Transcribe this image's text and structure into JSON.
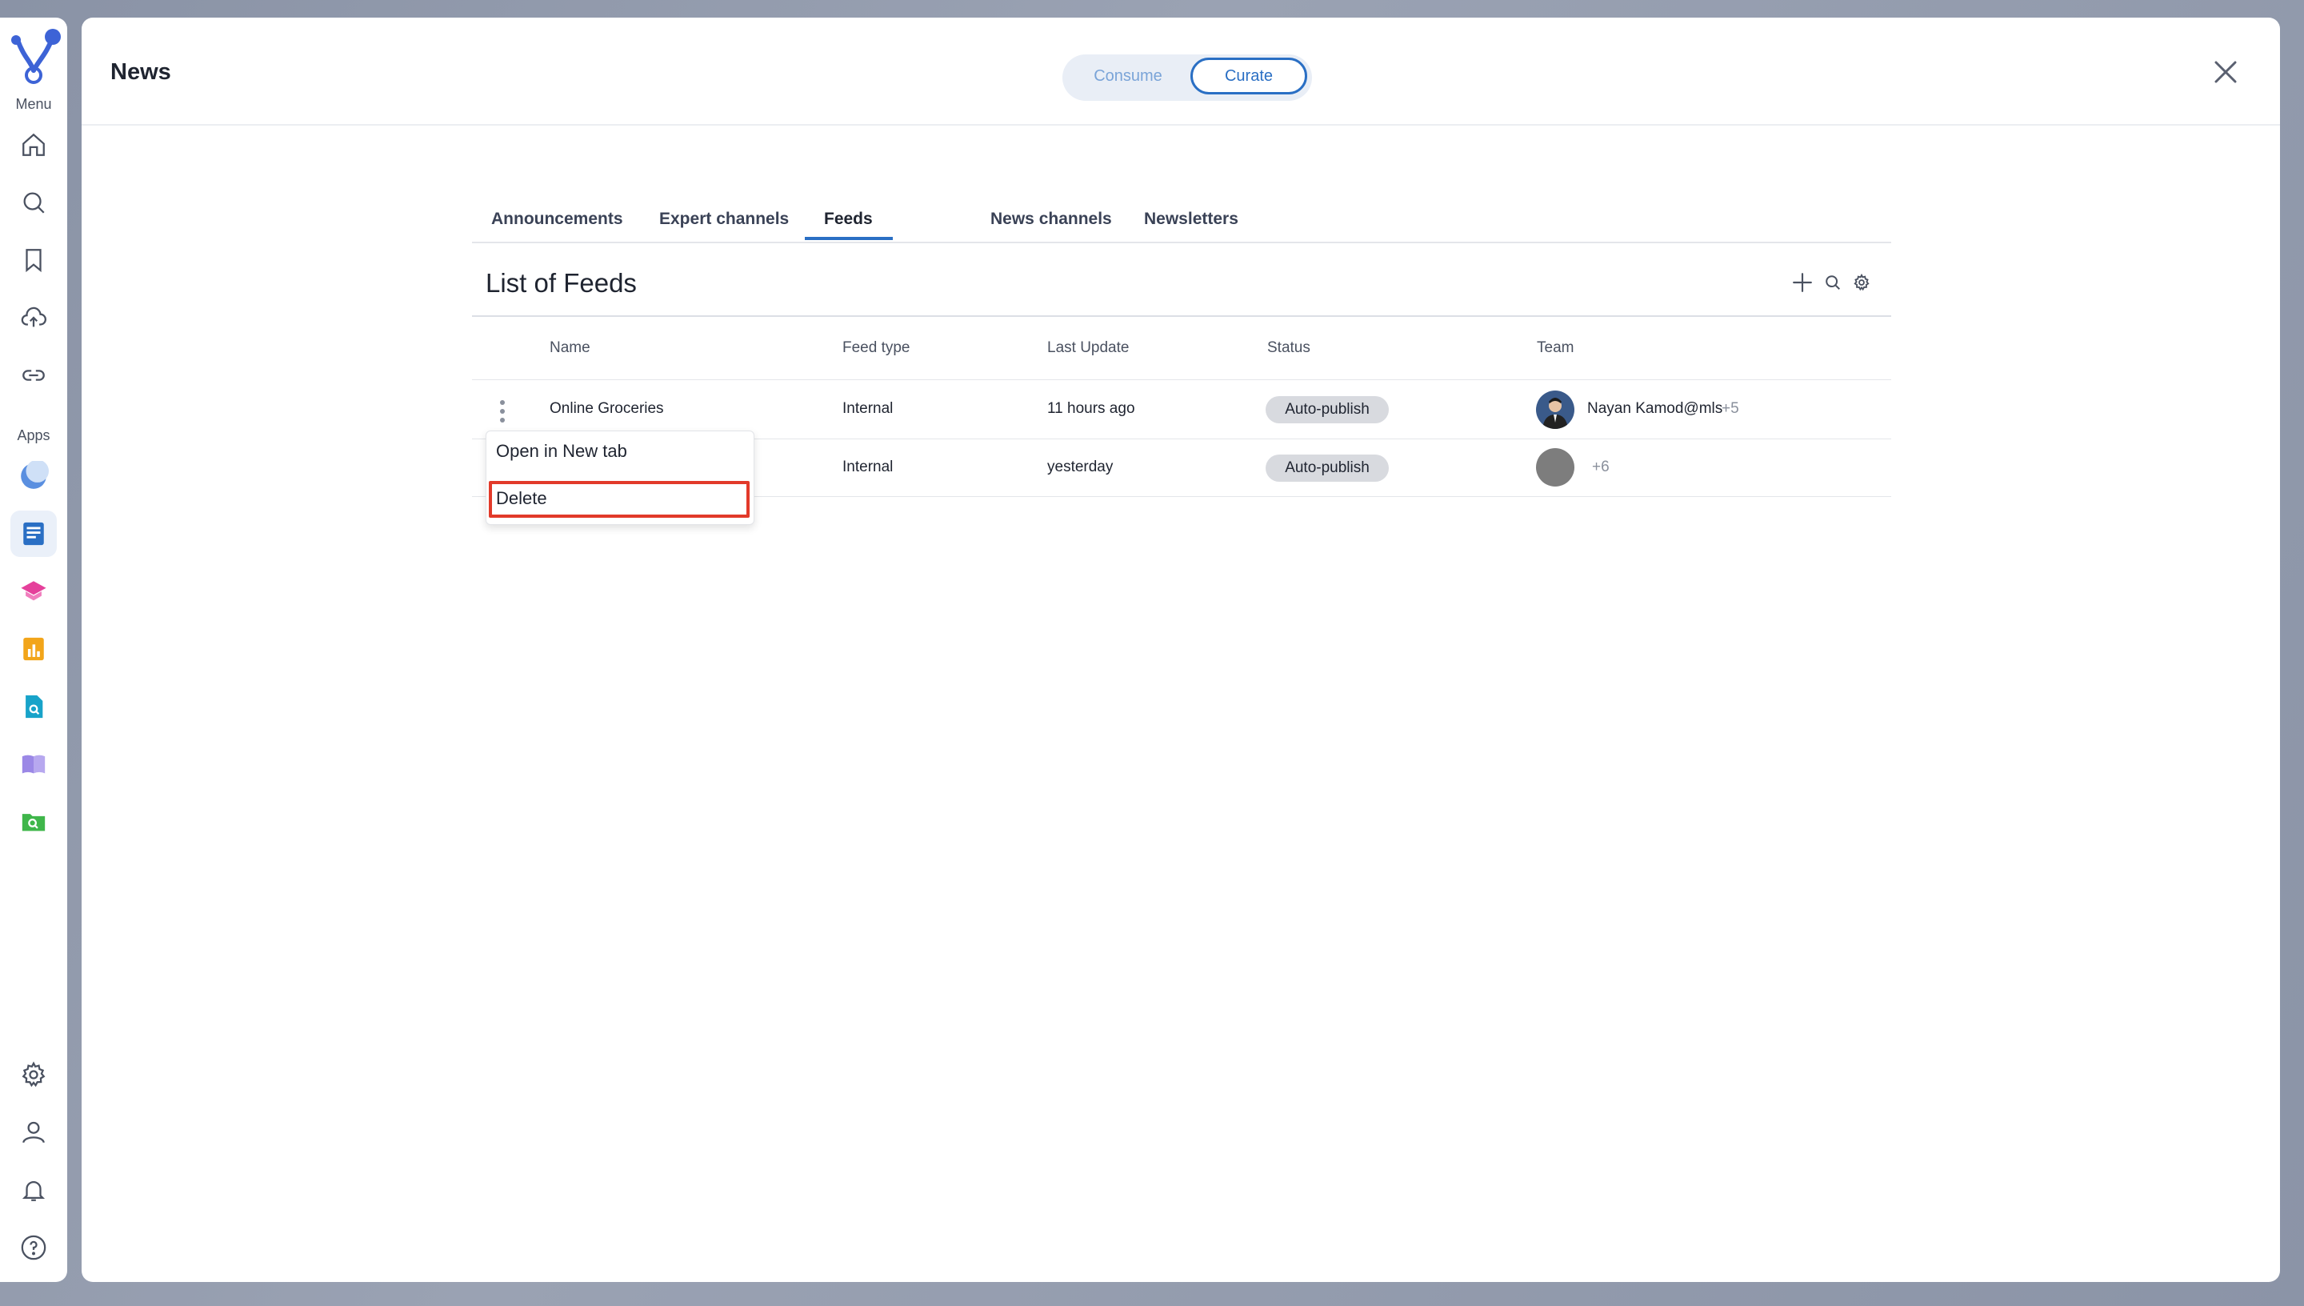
{
  "rail": {
    "menu_label": "Menu",
    "apps_label": "Apps",
    "nav_icons": [
      "home-icon",
      "search-icon",
      "bookmark-icon",
      "cloud-upload-icon",
      "link-icon"
    ],
    "app_icons": [
      "crescent-app-icon",
      "news-app-icon",
      "education-app-icon",
      "analytics-app-icon",
      "document-search-app-icon",
      "book-app-icon",
      "folder-search-app-icon"
    ],
    "bottom_icons": [
      "gear-icon",
      "user-icon",
      "bell-icon",
      "help-icon"
    ],
    "colors": {
      "brand": "#3d63d6",
      "active_bg": "#eaf0f9"
    }
  },
  "header": {
    "title": "News",
    "toggle": {
      "consume": "Consume",
      "curate": "Curate",
      "selected": "Curate"
    }
  },
  "tabs": [
    {
      "label": "Announcements"
    },
    {
      "label": "Expert channels"
    },
    {
      "label": "Feeds",
      "active": true
    },
    {
      "label": "News channels"
    },
    {
      "label": "Newsletters"
    }
  ],
  "section": {
    "title": "List of Feeds",
    "actions": [
      "plus-icon",
      "search-icon",
      "gear-icon"
    ]
  },
  "table": {
    "columns": [
      "Name",
      "Feed type",
      "Last Update",
      "Status",
      "Team"
    ],
    "rows": [
      {
        "name": "Online Groceries",
        "feed_type": "Internal",
        "last_update": "11 hours ago",
        "status": "Auto-publish",
        "team_member": "Nayan Kamod@mls",
        "team_more": "+5"
      },
      {
        "name": "",
        "feed_type": "Internal",
        "last_update": "yesterday",
        "status": "Auto-publish",
        "team_member": "",
        "team_more": "+6"
      }
    ]
  },
  "context_menu": {
    "items": [
      "Open in New tab",
      "Delete"
    ],
    "highlighted": "Delete",
    "highlight_color": "#e23a2a"
  }
}
